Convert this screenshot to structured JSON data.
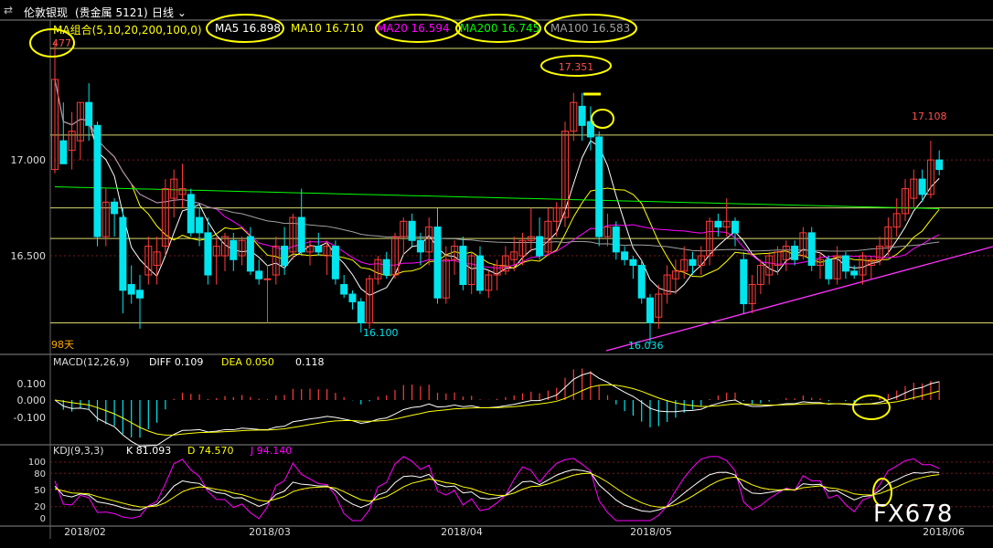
{
  "header": {
    "icon": "swap-icon",
    "symbol": "伦敦银现",
    "market": "(贵金属 5121)",
    "period": "日线",
    "chevron": "chevron-down-icon"
  },
  "colors": {
    "bull": "#ff3b3b",
    "bear": "#00e5ee",
    "ma5": "#ffffff",
    "ma10": "#ffff00",
    "ma20": "#ff00ff",
    "ma200": "#00ff00",
    "ma100": "#a0a0a0",
    "annotation": "#ffff00"
  },
  "main": {
    "ma_group": "MA组合(5,10,20,200,100,0)",
    "ma5": "MA5 16.898",
    "ma10": "MA10 16.710",
    "ma20": "MA20 16.594",
    "ma200": "MA200 16.745",
    "ma100": "MA100 16.583",
    "high_left": "477",
    "peak": "17.351",
    "last_high": "17.108",
    "low1": "16.100",
    "low2": "16.036",
    "days": "98天",
    "yticks": [
      "17.000",
      "16.500"
    ]
  },
  "macd": {
    "title": "MACD(12,26,9)",
    "diff": "DIFF 0.109",
    "dea": "DEA 0.050",
    "macd": "0.118",
    "yticks": [
      "0.100",
      "0.000",
      "-0.100"
    ]
  },
  "kdj": {
    "title": "KDJ(9,3,3)",
    "k": "K 81.093",
    "d": "D 74.570",
    "j": "J 94.140",
    "yticks": [
      "100",
      "80",
      "50",
      "20",
      "0"
    ]
  },
  "xaxis": [
    "2018/02",
    "2018/03",
    "2018/04",
    "2018/05",
    "2018/06"
  ],
  "watermark": "FX678",
  "chart_data": {
    "type": "candlestick",
    "price_ylim": [
      16.0,
      17.62
    ],
    "horizontal_levels": [
      17.13,
      16.75,
      16.59,
      16.15
    ],
    "candles": [
      {
        "o": 16.95,
        "h": 17.62,
        "l": 16.93,
        "c": 17.42
      },
      {
        "o": 17.1,
        "h": 17.3,
        "l": 16.98,
        "c": 16.98
      },
      {
        "o": 17.05,
        "h": 17.25,
        "l": 16.95,
        "c": 17.15
      },
      {
        "o": 17.1,
        "h": 17.3,
        "l": 17.0,
        "c": 17.3
      },
      {
        "o": 17.3,
        "h": 17.4,
        "l": 17.1,
        "c": 17.18
      },
      {
        "o": 17.18,
        "h": 17.2,
        "l": 16.55,
        "c": 16.6
      },
      {
        "o": 16.6,
        "h": 16.85,
        "l": 16.55,
        "c": 16.78
      },
      {
        "o": 16.78,
        "h": 16.8,
        "l": 16.6,
        "c": 16.72
      },
      {
        "o": 16.7,
        "h": 16.75,
        "l": 16.2,
        "c": 16.32
      },
      {
        "o": 16.35,
        "h": 16.45,
        "l": 16.25,
        "c": 16.3
      },
      {
        "o": 16.32,
        "h": 16.4,
        "l": 16.12,
        "c": 16.28
      },
      {
        "o": 16.4,
        "h": 16.6,
        "l": 16.35,
        "c": 16.55
      },
      {
        "o": 16.45,
        "h": 16.6,
        "l": 16.35,
        "c": 16.52
      },
      {
        "o": 16.55,
        "h": 16.9,
        "l": 16.5,
        "c": 16.85
      },
      {
        "o": 16.8,
        "h": 16.95,
        "l": 16.7,
        "c": 16.9
      },
      {
        "o": 16.82,
        "h": 16.98,
        "l": 16.75,
        "c": 16.85
      },
      {
        "o": 16.82,
        "h": 16.85,
        "l": 16.6,
        "c": 16.62
      },
      {
        "o": 16.7,
        "h": 16.75,
        "l": 16.55,
        "c": 16.62
      },
      {
        "o": 16.62,
        "h": 16.7,
        "l": 16.35,
        "c": 16.4
      },
      {
        "o": 16.5,
        "h": 16.6,
        "l": 16.35,
        "c": 16.55
      },
      {
        "o": 16.5,
        "h": 16.62,
        "l": 16.42,
        "c": 16.6
      },
      {
        "o": 16.58,
        "h": 16.62,
        "l": 16.42,
        "c": 16.48
      },
      {
        "o": 16.5,
        "h": 16.6,
        "l": 16.45,
        "c": 16.58
      },
      {
        "o": 16.6,
        "h": 16.65,
        "l": 16.4,
        "c": 16.42
      },
      {
        "o": 16.42,
        "h": 16.48,
        "l": 16.35,
        "c": 16.38
      },
      {
        "o": 16.38,
        "h": 16.45,
        "l": 16.15,
        "c": 16.38
      },
      {
        "o": 16.4,
        "h": 16.6,
        "l": 16.35,
        "c": 16.55
      },
      {
        "o": 16.55,
        "h": 16.65,
        "l": 16.4,
        "c": 16.45
      },
      {
        "o": 16.52,
        "h": 16.72,
        "l": 16.48,
        "c": 16.7
      },
      {
        "o": 16.7,
        "h": 16.85,
        "l": 16.5,
        "c": 16.52
      },
      {
        "o": 16.52,
        "h": 16.58,
        "l": 16.45,
        "c": 16.55
      },
      {
        "o": 16.55,
        "h": 16.62,
        "l": 16.5,
        "c": 16.52
      },
      {
        "o": 16.5,
        "h": 16.58,
        "l": 16.4,
        "c": 16.55
      },
      {
        "o": 16.55,
        "h": 16.58,
        "l": 16.35,
        "c": 16.38
      },
      {
        "o": 16.35,
        "h": 16.4,
        "l": 16.28,
        "c": 16.3
      },
      {
        "o": 16.3,
        "h": 16.32,
        "l": 16.22,
        "c": 16.26
      },
      {
        "o": 16.26,
        "h": 16.28,
        "l": 16.1,
        "c": 16.15
      },
      {
        "o": 16.15,
        "h": 16.4,
        "l": 16.12,
        "c": 16.38
      },
      {
        "o": 16.38,
        "h": 16.5,
        "l": 16.35,
        "c": 16.48
      },
      {
        "o": 16.48,
        "h": 16.52,
        "l": 16.38,
        "c": 16.4
      },
      {
        "o": 16.4,
        "h": 16.62,
        "l": 16.38,
        "c": 16.6
      },
      {
        "o": 16.6,
        "h": 16.7,
        "l": 16.5,
        "c": 16.68
      },
      {
        "o": 16.68,
        "h": 16.72,
        "l": 16.55,
        "c": 16.58
      },
      {
        "o": 16.58,
        "h": 16.62,
        "l": 16.45,
        "c": 16.52
      },
      {
        "o": 16.52,
        "h": 16.7,
        "l": 16.45,
        "c": 16.65
      },
      {
        "o": 16.65,
        "h": 16.75,
        "l": 16.25,
        "c": 16.28
      },
      {
        "o": 16.28,
        "h": 16.55,
        "l": 16.25,
        "c": 16.48
      },
      {
        "o": 16.48,
        "h": 16.58,
        "l": 16.4,
        "c": 16.55
      },
      {
        "o": 16.55,
        "h": 16.6,
        "l": 16.32,
        "c": 16.35
      },
      {
        "o": 16.35,
        "h": 16.52,
        "l": 16.3,
        "c": 16.5
      },
      {
        "o": 16.5,
        "h": 16.55,
        "l": 16.3,
        "c": 16.32
      },
      {
        "o": 16.32,
        "h": 16.42,
        "l": 16.28,
        "c": 16.4
      },
      {
        "o": 16.4,
        "h": 16.48,
        "l": 16.32,
        "c": 16.45
      },
      {
        "o": 16.42,
        "h": 16.55,
        "l": 16.4,
        "c": 16.5
      },
      {
        "o": 16.48,
        "h": 16.6,
        "l": 16.42,
        "c": 16.52
      },
      {
        "o": 16.5,
        "h": 16.62,
        "l": 16.45,
        "c": 16.58
      },
      {
        "o": 16.58,
        "h": 16.75,
        "l": 16.52,
        "c": 16.6
      },
      {
        "o": 16.6,
        "h": 16.7,
        "l": 16.48,
        "c": 16.5
      },
      {
        "o": 16.52,
        "h": 16.75,
        "l": 16.5,
        "c": 16.68
      },
      {
        "o": 16.68,
        "h": 16.78,
        "l": 16.6,
        "c": 16.75
      },
      {
        "o": 16.7,
        "h": 17.2,
        "l": 16.65,
        "c": 17.15
      },
      {
        "o": 17.15,
        "h": 17.35,
        "l": 17.1,
        "c": 17.3
      },
      {
        "o": 17.28,
        "h": 17.35,
        "l": 17.1,
        "c": 17.18
      },
      {
        "o": 17.2,
        "h": 17.28,
        "l": 17.05,
        "c": 17.12
      },
      {
        "o": 17.12,
        "h": 17.15,
        "l": 16.55,
        "c": 16.6
      },
      {
        "o": 16.6,
        "h": 16.72,
        "l": 16.55,
        "c": 16.65
      },
      {
        "o": 16.65,
        "h": 16.68,
        "l": 16.48,
        "c": 16.52
      },
      {
        "o": 16.52,
        "h": 16.55,
        "l": 16.45,
        "c": 16.48
      },
      {
        "o": 16.48,
        "h": 16.5,
        "l": 16.38,
        "c": 16.45
      },
      {
        "o": 16.45,
        "h": 16.48,
        "l": 16.25,
        "c": 16.28
      },
      {
        "o": 16.28,
        "h": 16.3,
        "l": 16.04,
        "c": 16.15
      },
      {
        "o": 16.18,
        "h": 16.35,
        "l": 16.12,
        "c": 16.3
      },
      {
        "o": 16.3,
        "h": 16.45,
        "l": 16.25,
        "c": 16.4
      },
      {
        "o": 16.38,
        "h": 16.48,
        "l": 16.3,
        "c": 16.42
      },
      {
        "o": 16.42,
        "h": 16.55,
        "l": 16.38,
        "c": 16.48
      },
      {
        "o": 16.48,
        "h": 16.52,
        "l": 16.4,
        "c": 16.45
      },
      {
        "o": 16.45,
        "h": 16.55,
        "l": 16.4,
        "c": 16.5
      },
      {
        "o": 16.5,
        "h": 16.7,
        "l": 16.45,
        "c": 16.68
      },
      {
        "o": 16.68,
        "h": 16.72,
        "l": 16.6,
        "c": 16.65
      },
      {
        "o": 16.65,
        "h": 16.8,
        "l": 16.6,
        "c": 16.68
      },
      {
        "o": 16.68,
        "h": 16.7,
        "l": 16.55,
        "c": 16.62
      },
      {
        "o": 16.48,
        "h": 16.52,
        "l": 16.2,
        "c": 16.25
      },
      {
        "o": 16.25,
        "h": 16.4,
        "l": 16.2,
        "c": 16.35
      },
      {
        "o": 16.35,
        "h": 16.48,
        "l": 16.3,
        "c": 16.45
      },
      {
        "o": 16.4,
        "h": 16.52,
        "l": 16.35,
        "c": 16.5
      },
      {
        "o": 16.45,
        "h": 16.55,
        "l": 16.4,
        "c": 16.52
      },
      {
        "o": 16.48,
        "h": 16.58,
        "l": 16.42,
        "c": 16.55
      },
      {
        "o": 16.55,
        "h": 16.58,
        "l": 16.45,
        "c": 16.48
      },
      {
        "o": 16.5,
        "h": 16.65,
        "l": 16.48,
        "c": 16.62
      },
      {
        "o": 16.62,
        "h": 16.65,
        "l": 16.42,
        "c": 16.45
      },
      {
        "o": 16.45,
        "h": 16.52,
        "l": 16.38,
        "c": 16.48
      },
      {
        "o": 16.48,
        "h": 16.5,
        "l": 16.35,
        "c": 16.38
      },
      {
        "o": 16.38,
        "h": 16.55,
        "l": 16.35,
        "c": 16.5
      },
      {
        "o": 16.5,
        "h": 16.52,
        "l": 16.38,
        "c": 16.42
      },
      {
        "o": 16.42,
        "h": 16.45,
        "l": 16.38,
        "c": 16.4
      },
      {
        "o": 16.4,
        "h": 16.52,
        "l": 16.35,
        "c": 16.5
      },
      {
        "o": 16.45,
        "h": 16.5,
        "l": 16.38,
        "c": 16.48
      },
      {
        "o": 16.48,
        "h": 16.6,
        "l": 16.45,
        "c": 16.55
      },
      {
        "o": 16.55,
        "h": 16.7,
        "l": 16.5,
        "c": 16.65
      },
      {
        "o": 16.65,
        "h": 16.8,
        "l": 16.6,
        "c": 16.72
      },
      {
        "o": 16.72,
        "h": 16.9,
        "l": 16.68,
        "c": 16.85
      },
      {
        "o": 16.8,
        "h": 16.95,
        "l": 16.75,
        "c": 16.9
      },
      {
        "o": 16.9,
        "h": 16.95,
        "l": 16.78,
        "c": 16.82
      },
      {
        "o": 16.82,
        "h": 17.1,
        "l": 16.8,
        "c": 17.0
      },
      {
        "o": 17.0,
        "h": 17.05,
        "l": 16.92,
        "c": 16.95
      }
    ]
  }
}
